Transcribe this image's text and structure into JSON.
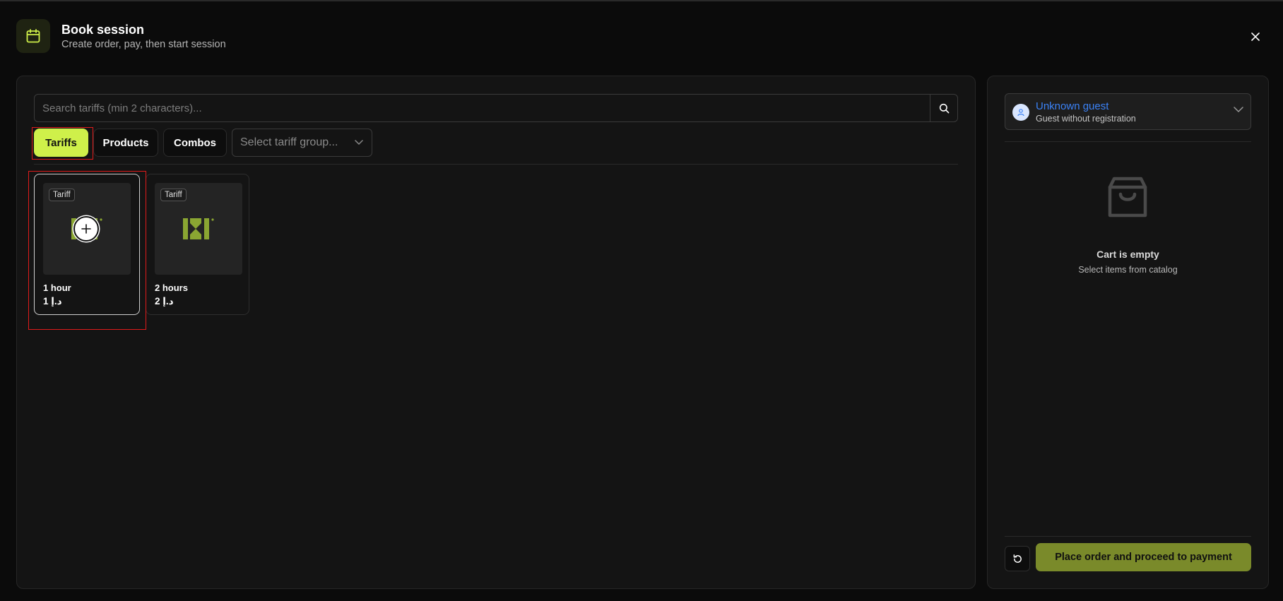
{
  "header": {
    "title": "Book session",
    "subtitle": "Create order, pay, then start session",
    "icon": "calendar-icon",
    "close_icon": "close-icon"
  },
  "search": {
    "placeholder": "Search tariffs (min 2 characters)...",
    "value": "",
    "icon": "search-icon"
  },
  "tabs": [
    {
      "label": "Tariffs",
      "active": true
    },
    {
      "label": "Products",
      "active": false
    },
    {
      "label": "Combos",
      "active": false
    }
  ],
  "tariff_group_select": {
    "placeholder": "Select tariff group..."
  },
  "catalog": [
    {
      "badge": "Tariff",
      "name": "1 hour",
      "price": "1 د.إ",
      "selected": true
    },
    {
      "badge": "Tariff",
      "name": "2 hours",
      "price": "2 د.إ",
      "selected": false
    }
  ],
  "guest": {
    "name": "Unknown guest",
    "subtitle": "Guest without registration"
  },
  "cart": {
    "empty_title": "Cart is empty",
    "empty_subtitle": "Select items from catalog"
  },
  "actions": {
    "order_label": "Place order and proceed to payment"
  },
  "colors": {
    "accent": "#cff04a",
    "order_button": "#7a8a2a",
    "guest_name": "#3b82f6",
    "logo_green": "#8aa632",
    "highlight_red": "#e01b1b"
  }
}
